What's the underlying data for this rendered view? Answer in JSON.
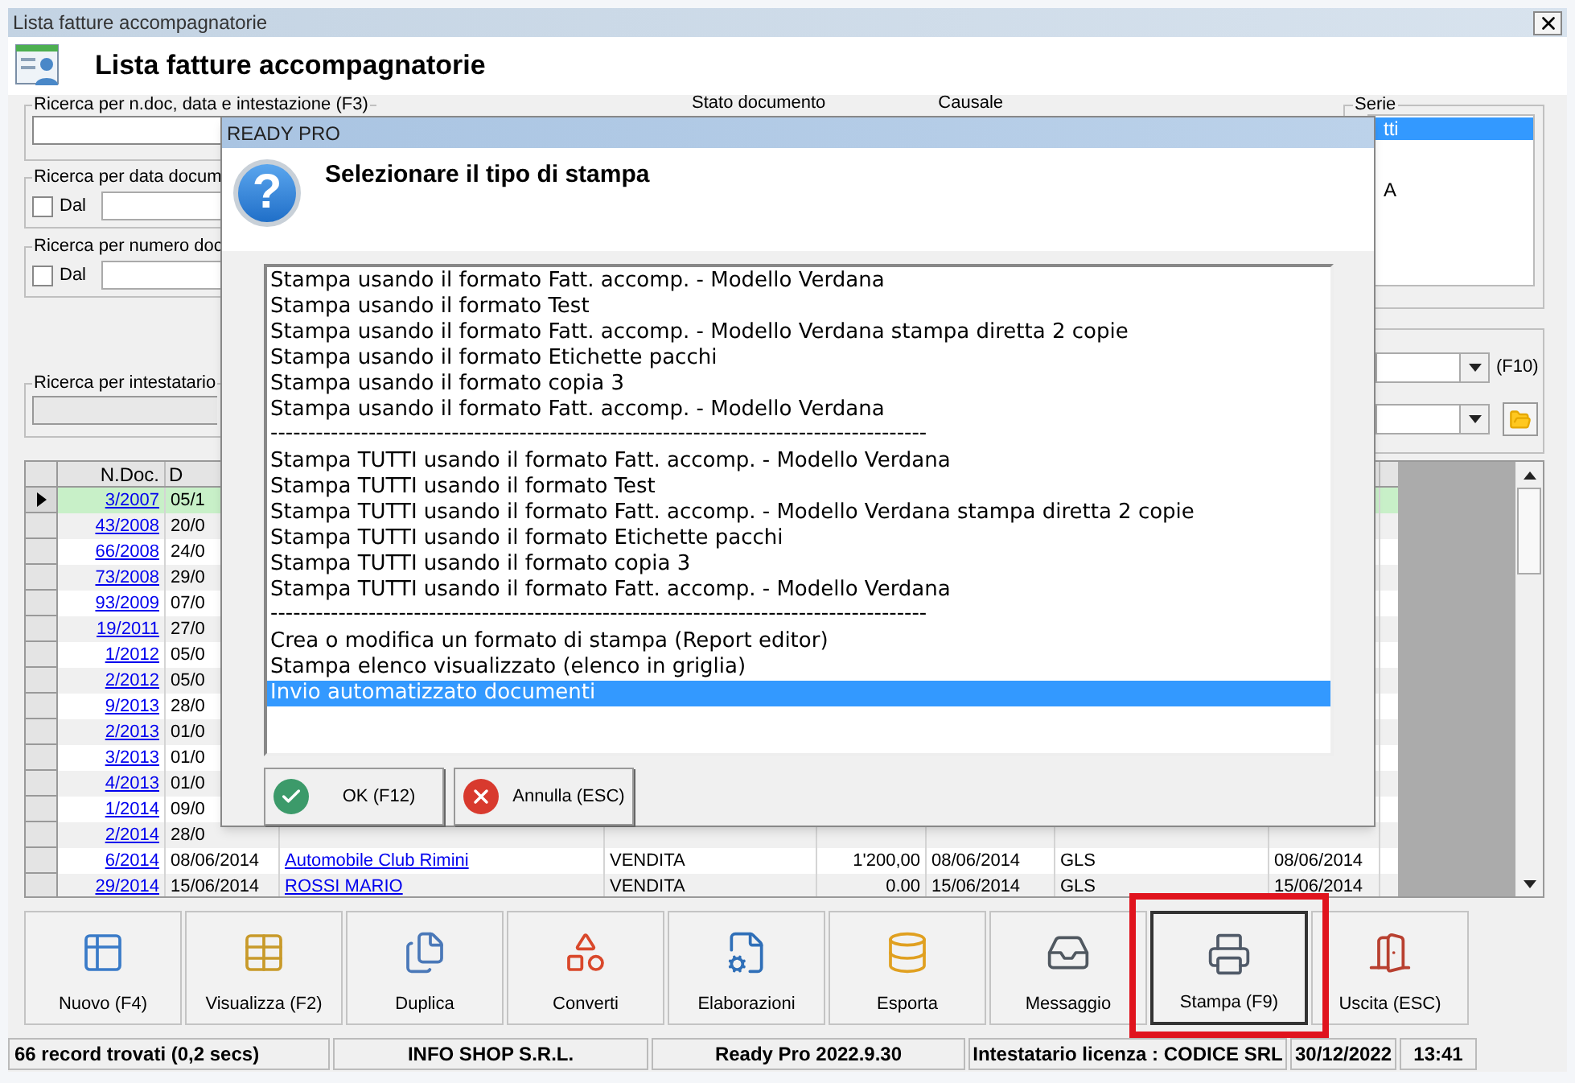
{
  "window": {
    "title": "Lista fatture accompagnatorie"
  },
  "header": {
    "title": "Lista fatture accompagnatorie"
  },
  "filters": {
    "search": {
      "label": "Ricerca per n.doc, data e intestazione (F3)"
    },
    "by_date": {
      "label": "Ricerca per data docum",
      "checkbox_label": "Dal",
      "checked": false
    },
    "by_number": {
      "label": "Ricerca per numero doc",
      "checkbox_label": "Dal",
      "checked": false
    },
    "by_holder": {
      "label": "Ricerca per intestatario",
      "disabled": true
    },
    "status_label": "Stato documento",
    "reason_label": "Causale",
    "series": {
      "label": "Serie",
      "items": [
        {
          "text": "tti",
          "selected": true
        },
        {
          "text": "A",
          "selected": false
        }
      ]
    },
    "shortcut": "(F10)"
  },
  "table": {
    "columns": [
      "N.Doc.",
      "D"
    ],
    "rows": [
      {
        "selected": true,
        "cells": [
          "3/2007",
          "05/1"
        ]
      },
      {
        "selected": false,
        "cells": [
          "43/2008",
          "20/0"
        ]
      },
      {
        "selected": false,
        "cells": [
          "66/2008",
          "24/0"
        ]
      },
      {
        "selected": false,
        "cells": [
          "73/2008",
          "29/0"
        ]
      },
      {
        "selected": false,
        "cells": [
          "93/2009",
          "07/0"
        ]
      },
      {
        "selected": false,
        "cells": [
          "19/2011",
          "27/0"
        ]
      },
      {
        "selected": false,
        "cells": [
          "1/2012",
          "05/0"
        ]
      },
      {
        "selected": false,
        "cells": [
          "2/2012",
          "05/0"
        ]
      },
      {
        "selected": false,
        "cells": [
          "9/2013",
          "28/0"
        ]
      },
      {
        "selected": false,
        "cells": [
          "2/2013",
          "01/0"
        ]
      },
      {
        "selected": false,
        "cells": [
          "3/2013",
          "01/0"
        ]
      },
      {
        "selected": false,
        "cells": [
          "4/2013",
          "01/0"
        ]
      },
      {
        "selected": false,
        "cells": [
          "1/2014",
          "09/0"
        ]
      },
      {
        "selected": false,
        "cells": [
          "2/2014",
          "28/0"
        ]
      },
      {
        "selected": false,
        "cells": [
          "6/2014",
          "08/06/2014",
          "Automobile Club Rimini",
          "VENDITA",
          "1'200,00",
          "08/06/2014",
          "GLS",
          "08/06/2014"
        ]
      },
      {
        "selected": false,
        "cells": [
          "29/2014",
          "15/06/2014",
          "ROSSI MARIO",
          "VENDITA",
          "0.00",
          "15/06/2014",
          "GLS",
          "15/06/2014"
        ]
      }
    ]
  },
  "dialog": {
    "title": "READY PRO",
    "icon_glyph": "?",
    "heading": "Selezionare il tipo di stampa",
    "options": [
      {
        "kind": "item",
        "text": "Stampa usando il formato Fatt. accomp. - Modello Verdana",
        "selected": false
      },
      {
        "kind": "item",
        "text": "Stampa usando il formato Test",
        "selected": false
      },
      {
        "kind": "item",
        "text": "Stampa usando il formato Fatt. accomp. - Modello Verdana  stampa diretta 2 copie",
        "selected": false
      },
      {
        "kind": "item",
        "text": "Stampa usando il formato Etichette pacchi",
        "selected": false
      },
      {
        "kind": "item",
        "text": "Stampa usando il formato copia 3",
        "selected": false
      },
      {
        "kind": "item",
        "text": "Stampa usando il formato Fatt. accomp. - Modello Verdana",
        "selected": false
      },
      {
        "kind": "separator",
        "text": "---------------------------------------------------------------------------------------",
        "selected": false
      },
      {
        "kind": "item",
        "text": "Stampa TUTTI usando il formato Fatt. accomp. - Modello Verdana",
        "selected": false
      },
      {
        "kind": "item",
        "text": "Stampa TUTTI usando il formato Test",
        "selected": false
      },
      {
        "kind": "item",
        "text": "Stampa TUTTI usando il formato Fatt. accomp. - Modello Verdana  stampa diretta 2 copie",
        "selected": false
      },
      {
        "kind": "item",
        "text": "Stampa TUTTI usando il formato Etichette pacchi",
        "selected": false
      },
      {
        "kind": "item",
        "text": "Stampa TUTTI usando il formato copia 3",
        "selected": false
      },
      {
        "kind": "item",
        "text": "Stampa TUTTI usando il formato Fatt. accomp. - Modello Verdana",
        "selected": false
      },
      {
        "kind": "separator",
        "text": "---------------------------------------------------------------------------------------",
        "selected": false
      },
      {
        "kind": "item",
        "text": "Crea o modifica un formato di stampa (Report editor)",
        "selected": false
      },
      {
        "kind": "item",
        "text": "Stampa elenco visualizzato (elenco in griglia)",
        "selected": false
      },
      {
        "kind": "item",
        "text": "Invio automatizzato documenti",
        "selected": true
      }
    ],
    "buttons": [
      {
        "kind": "ok",
        "label": "OK (F12)"
      },
      {
        "kind": "cancel",
        "label": "Annulla (ESC)"
      }
    ]
  },
  "toolbar": [
    {
      "label": "Nuovo (F4)",
      "highlighted": false
    },
    {
      "label": "Visualizza (F2)",
      "highlighted": false
    },
    {
      "label": "Duplica",
      "highlighted": false
    },
    {
      "label": "Converti",
      "highlighted": false
    },
    {
      "label": "Elaborazioni",
      "highlighted": false
    },
    {
      "label": "Esporta",
      "highlighted": false
    },
    {
      "label": "Messaggio",
      "highlighted": false
    },
    {
      "label": "Stampa (F9)",
      "highlighted": true
    },
    {
      "label": "Uscita (ESC)",
      "highlighted": false
    }
  ],
  "status_bar": [
    "66 record trovati (0,2 secs)",
    "INFO SHOP S.R.L.",
    "Ready Pro 2022.9.30",
    "Intestatario licenza : CODICE SRL",
    "30/12/2022",
    "13:41"
  ]
}
